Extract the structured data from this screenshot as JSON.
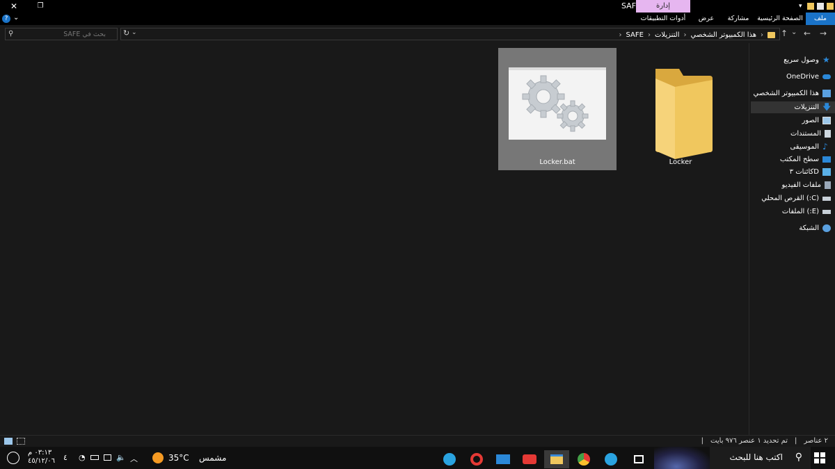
{
  "window": {
    "title": "SAFE",
    "manage_label": "إدارة",
    "close_glyph": "✕",
    "restore_glyph": "❐"
  },
  "ribbon": {
    "tabs": [
      {
        "label": "ملف"
      },
      {
        "label": "الصفحة الرئيسية"
      },
      {
        "label": "مشاركة"
      },
      {
        "label": "عرض"
      },
      {
        "label": "أدوات التطبيقات"
      }
    ],
    "help_glyph": "?",
    "expand_glyph": "⌄"
  },
  "address": {
    "breadcrumbs": [
      {
        "label": "هذا الكمبيوتر الشخصي"
      },
      {
        "label": "التنزيلات"
      },
      {
        "label": "SAFE"
      }
    ],
    "search_placeholder": "بحث في SAFE"
  },
  "files": [
    {
      "name": "Locker",
      "type": "folder",
      "selected": false
    },
    {
      "name": "Locker.bat",
      "type": "batch",
      "selected": true
    }
  ],
  "nav_pane": {
    "items": [
      {
        "label": "وصول سريع",
        "icon": "star-icon",
        "color": "#2b88d8"
      },
      {
        "label": "OneDrive",
        "icon": "cloud-icon",
        "color": "#2b88d8"
      },
      {
        "label": "هذا الكمبيوتر الشخصي",
        "icon": "computer-icon",
        "color": "#5aa0e0"
      },
      {
        "label": "التنزيلات",
        "icon": "download-icon",
        "color": "#2b88d8"
      },
      {
        "label": "الصور",
        "icon": "pictures-icon",
        "color": "#9cc7ea"
      },
      {
        "label": "المستندات",
        "icon": "documents-icon",
        "color": "#cfd8e0"
      },
      {
        "label": "الموسيقى",
        "icon": "music-icon",
        "color": "#2b88d8"
      },
      {
        "label": "سطح المكتب",
        "icon": "desktop-icon",
        "color": "#2b88d8"
      },
      {
        "label": "كائنات ۳D",
        "icon": "cube-icon",
        "color": "#5ab0e8"
      },
      {
        "label": "ملفات الفيديو",
        "icon": "video-icon",
        "color": "#9aa8b8"
      },
      {
        "label": "القرص المحلي (:C)",
        "icon": "drive-icon",
        "color": "#c8d0d8"
      },
      {
        "label": "الملفات (:E)",
        "icon": "drive-icon",
        "color": "#c8d0d8"
      },
      {
        "label": "الشبكة",
        "icon": "network-icon",
        "color": "#5aa0e0"
      }
    ]
  },
  "status": {
    "count": "٢ عناصر",
    "selection": "تم تحديد ١ عنصر ٩٧٦ بايت"
  },
  "taskbar": {
    "search_placeholder": "اكتب هنا للبحث",
    "weather_temp": "35°C",
    "weather_desc": "مشمس",
    "time": "٠٣:١٣ م",
    "date": "٤٥/١٢/٠٦",
    "notification_count": "٤"
  },
  "colors": {
    "accent": "#1a73c8",
    "manage_tab": "#e6b6f0",
    "folder": "#f0c75e",
    "background": "#191919"
  }
}
